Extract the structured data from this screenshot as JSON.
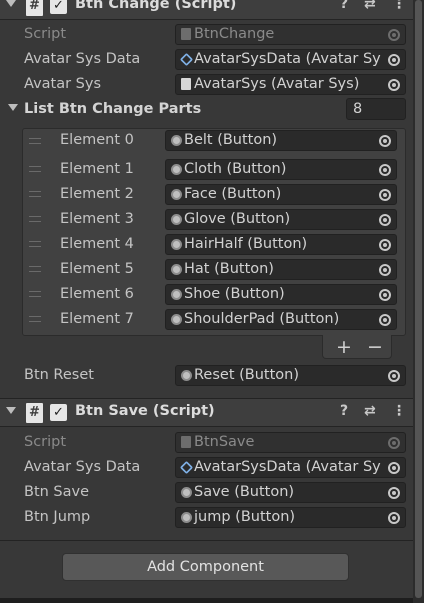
{
  "components": [
    {
      "title": "Btn Change (Script)",
      "header_icons": [
        "help-icon",
        "preset-icon",
        "more-icon"
      ],
      "fields": {
        "script_label": "Script",
        "script_value": "BtnChange",
        "avatar_sys_data_label": "Avatar Sys Data",
        "avatar_sys_data_value": "AvatarSysData (Avatar Sy",
        "avatar_sys_label": "Avatar Sys",
        "avatar_sys_value": "AvatarSys (Avatar Sys)"
      },
      "list": {
        "label": "List Btn Change Parts",
        "size": "8",
        "elements": [
          {
            "label": "Element 0",
            "value": "Belt (Button)"
          },
          {
            "label": "Element 1",
            "value": "Cloth (Button)"
          },
          {
            "label": "Element 2",
            "value": "Face (Button)"
          },
          {
            "label": "Element 3",
            "value": "Glove (Button)"
          },
          {
            "label": "Element 4",
            "value": "HairHalf (Button)"
          },
          {
            "label": "Element 5",
            "value": "Hat (Button)"
          },
          {
            "label": "Element 6",
            "value": "Shoe (Button)"
          },
          {
            "label": "Element 7",
            "value": "ShoulderPad (Button)"
          }
        ],
        "add_label": "+",
        "remove_label": "−"
      },
      "btn_reset_label": "Btn Reset",
      "btn_reset_value": "Reset (Button)"
    },
    {
      "title": "Btn Save (Script)",
      "fields": {
        "script_label": "Script",
        "script_value": "BtnSave",
        "avatar_sys_data_label": "Avatar Sys Data",
        "avatar_sys_data_value": "AvatarSysData (Avatar Sy",
        "btn_save_label": "Btn Save",
        "btn_save_value": "Save (Button)",
        "btn_jump_label": "Btn Jump",
        "btn_jump_value": "jump (Button)"
      }
    }
  ],
  "add_component_label": "Add Component",
  "glyphs": {
    "script": "#",
    "check": "✓",
    "help": "?",
    "preset": "⇄",
    "more": "⋮"
  }
}
